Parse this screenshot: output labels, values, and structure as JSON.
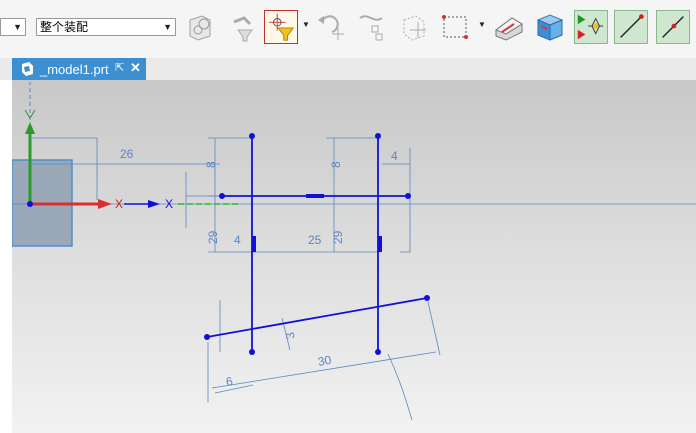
{
  "toolbar": {
    "selection_filter_value": "",
    "assembly_scope_value": "整个装配",
    "icons": [
      "assembly-filter-icon",
      "select-feature-icon",
      "snap-point-icon",
      "undo-snap-icon",
      "point-on-curve-icon",
      "constraint-icon",
      "hidden-box-icon",
      "rectangle-select-icon",
      "eraser-icon",
      "shaded-box-icon",
      "continuous-autodimension-icon",
      "line-icon",
      "line-point-icon"
    ]
  },
  "tab": {
    "title": "_model1.prt",
    "popout_glyph": "⇱",
    "close_glyph": "✕"
  },
  "viewport": {
    "axis_labels": {
      "x1": "X",
      "x2": "X"
    },
    "dimensions": {
      "d26": "26",
      "d8a": "8",
      "d8b": "8",
      "d4a": "4",
      "d4b": "4",
      "d29a": "29",
      "d29b": "29",
      "d25": "25",
      "d3": "3",
      "d30": "30",
      "d6": "6"
    }
  },
  "colors": {
    "sketch": "#1010d8",
    "dimension": "#5c86c0",
    "tab": "#3c8fd0",
    "x_axis": "#d83030",
    "y_axis": "#2a9a2a"
  }
}
